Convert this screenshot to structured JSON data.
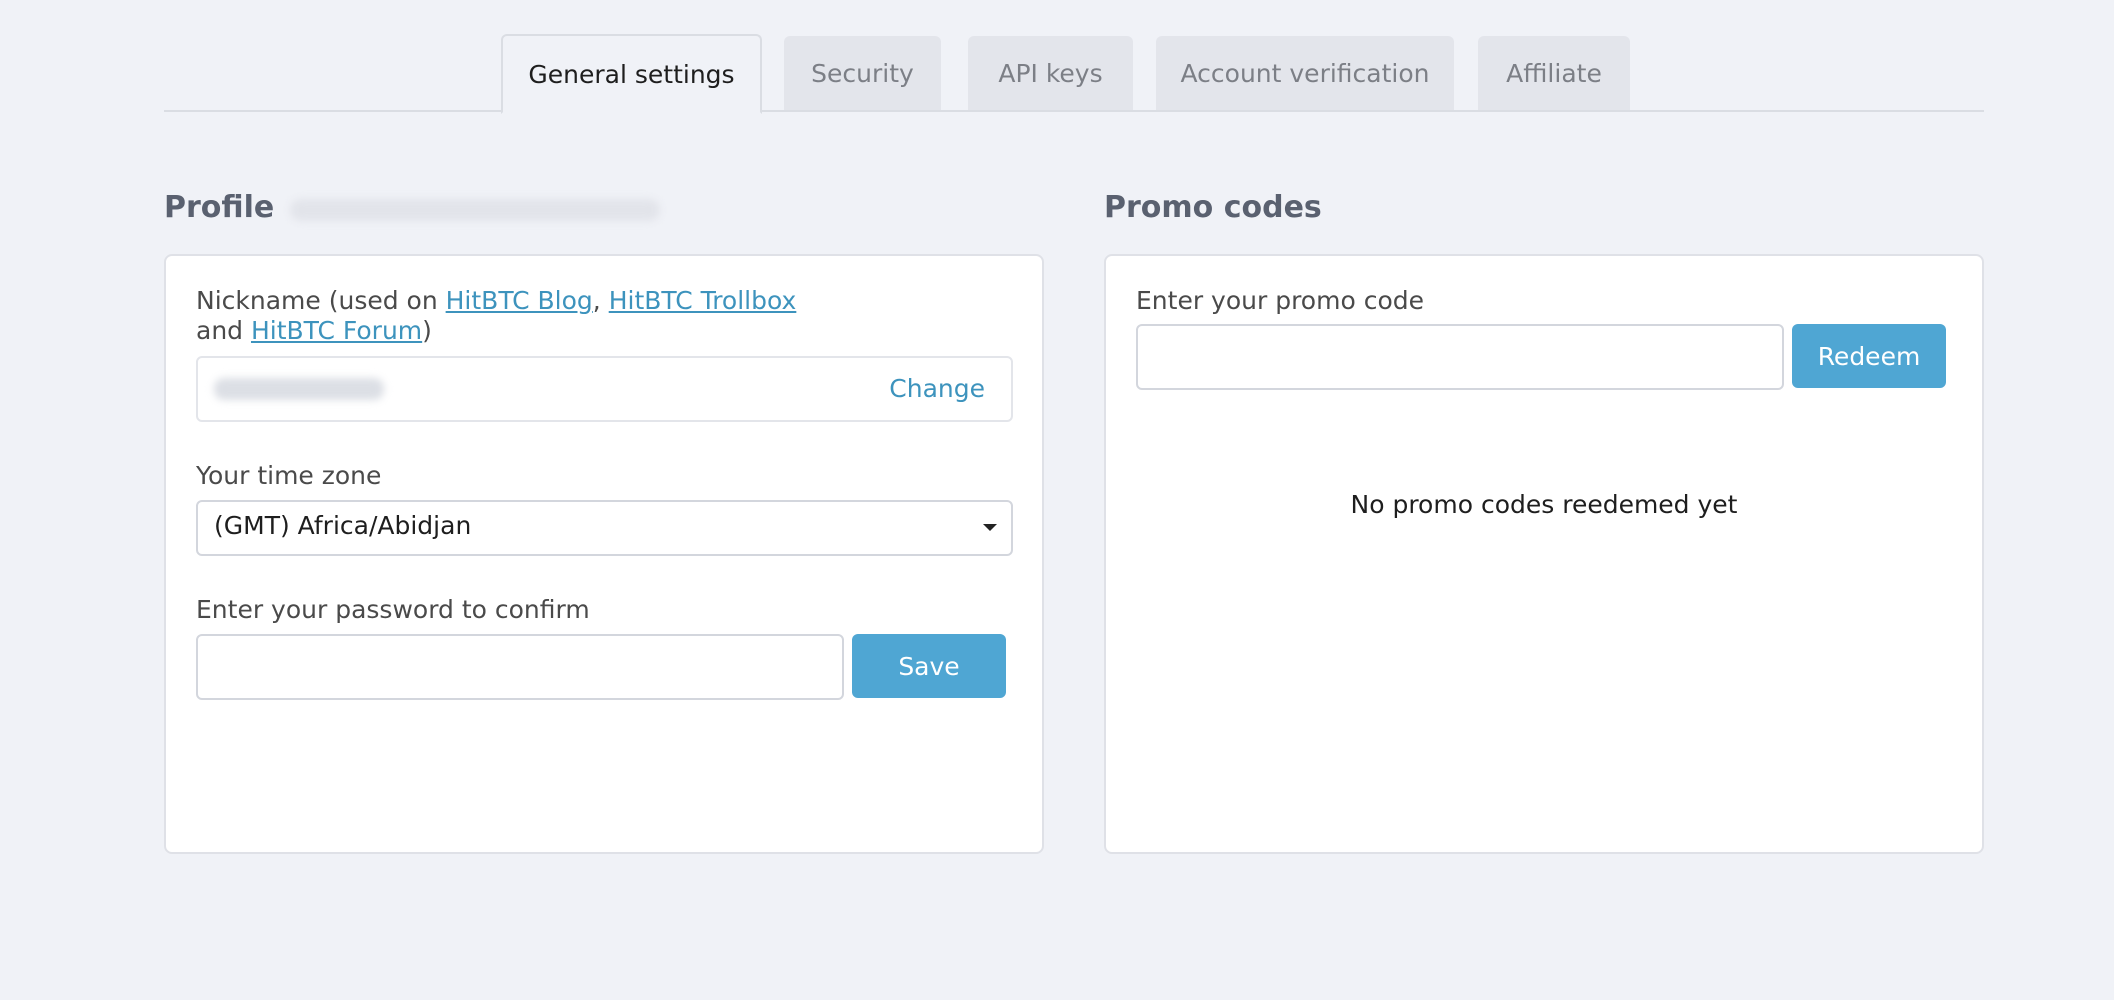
{
  "tabs": [
    {
      "label": "General settings",
      "active": true
    },
    {
      "label": "Security",
      "active": false
    },
    {
      "label": "API keys",
      "active": false
    },
    {
      "label": "Account verification",
      "active": false
    },
    {
      "label": "Affiliate",
      "active": false
    }
  ],
  "profile": {
    "title": "Profile",
    "nickname_label_prefix": "Nickname (used on ",
    "link_blog": "HitBTC Blog",
    "sep_comma": ", ",
    "link_trollbox": "HitBTC Trollbox",
    "line2_and": "and ",
    "link_forum": "HitBTC Forum",
    "close_paren": ")",
    "change_label": "Change",
    "timezone_label": "Your time zone",
    "timezone_value": "(GMT) Africa/Abidjan",
    "password_label": "Enter your password to confirm",
    "password_value": "",
    "save_label": "Save"
  },
  "promo": {
    "title": "Promo codes",
    "input_label": "Enter your promo code",
    "input_value": "",
    "redeem_label": "Redeem",
    "empty_message": "No promo codes reedemed yet"
  },
  "colors": {
    "background": "#f0f2f7",
    "accent_button": "#4fa6d3",
    "link": "#3d93bd",
    "heading": "#5a6170"
  }
}
